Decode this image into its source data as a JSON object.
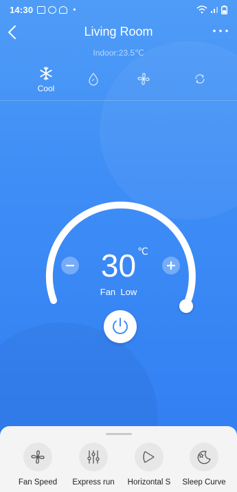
{
  "status_bar": {
    "time": "14:30",
    "dot": "•"
  },
  "header": {
    "title": "Living Room",
    "indoor": "Indoor:23.5℃"
  },
  "modes": [
    {
      "icon": "snowflake-icon",
      "label": "Cool",
      "active": true
    },
    {
      "icon": "droplet-icon",
      "label": "",
      "active": false
    },
    {
      "icon": "fan-icon",
      "label": "",
      "active": false
    },
    {
      "icon": "auto-cycle-icon",
      "label": "",
      "active": false
    }
  ],
  "dial": {
    "temperature": "30",
    "unit": "℃",
    "fan_status": "Fan  Low"
  },
  "functions": [
    {
      "icon": "fan-speed-icon",
      "label": "Fan Speed"
    },
    {
      "icon": "express-run-icon",
      "label": "Express run"
    },
    {
      "icon": "horizontal-swing-icon",
      "label": "Horizontal S"
    },
    {
      "icon": "sleep-curve-icon",
      "label": "Sleep Curve"
    }
  ],
  "colors": {
    "background": "#3f8ef6",
    "panel": "#f4f4f4",
    "power_icon": "#3f8ef6"
  }
}
